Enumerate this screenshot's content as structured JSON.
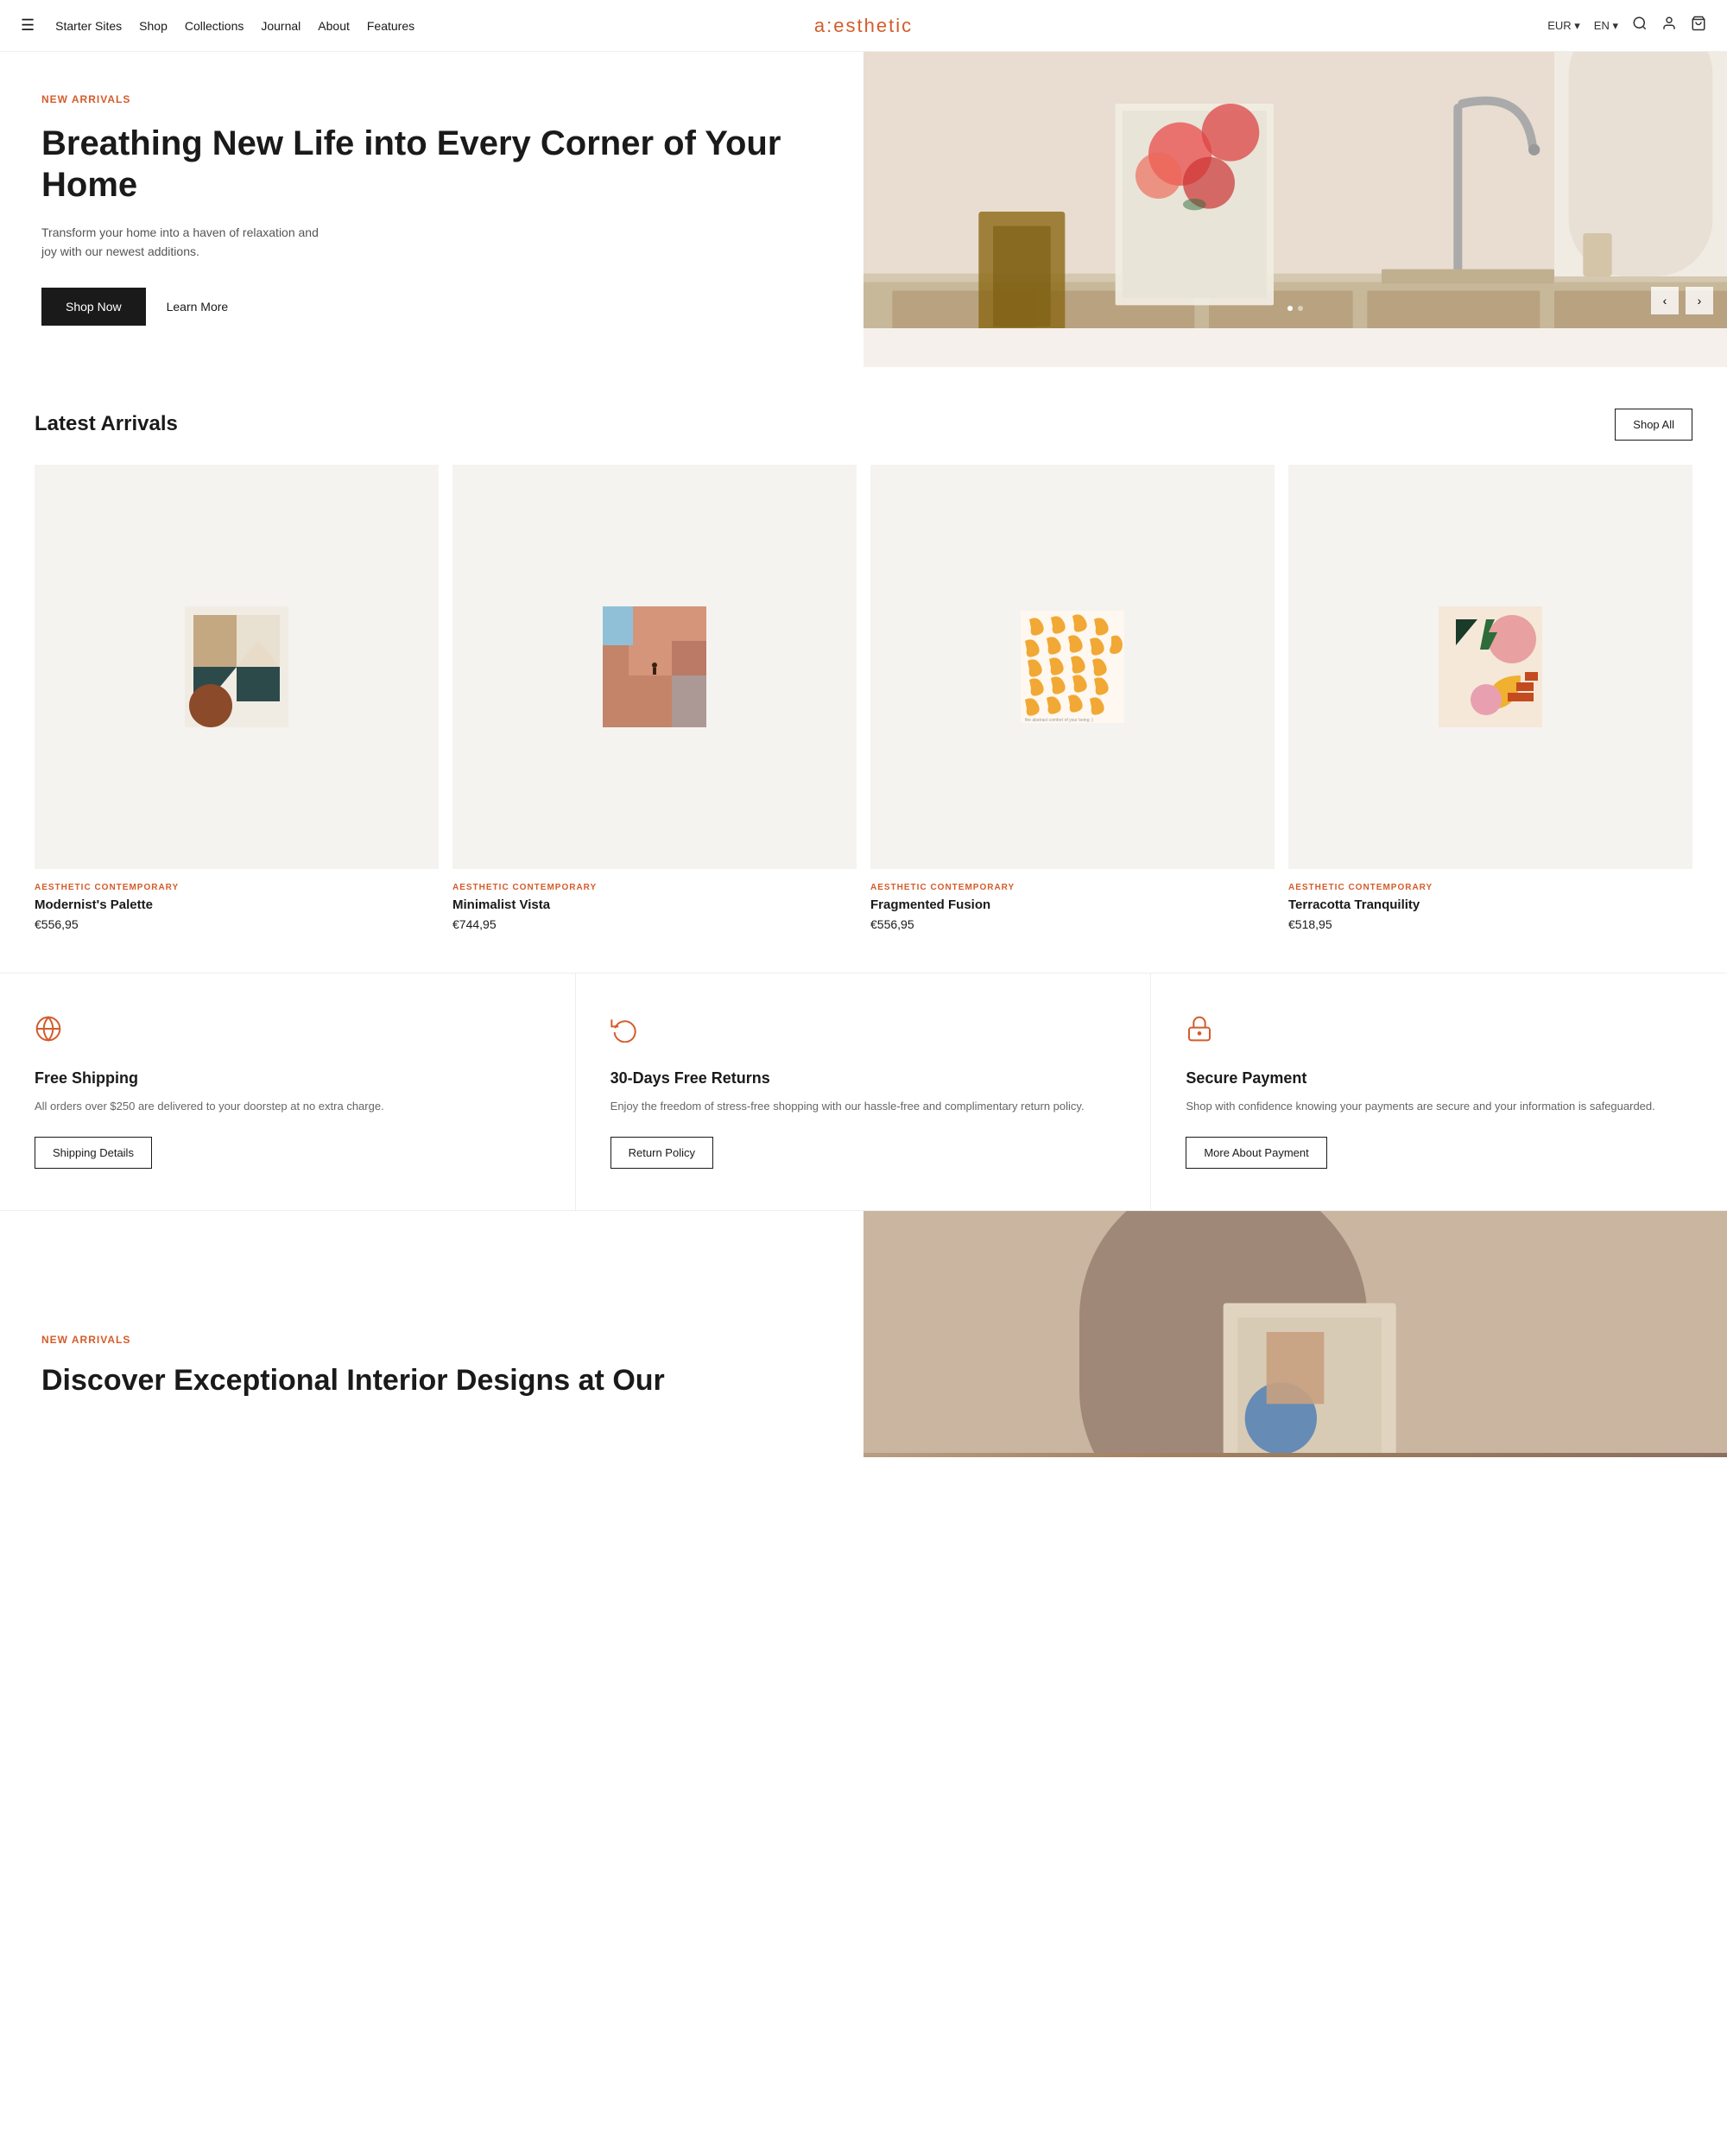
{
  "nav": {
    "hamburger": "☰",
    "links": [
      {
        "label": "Starter Sites",
        "id": "starter-sites"
      },
      {
        "label": "Shop",
        "id": "shop"
      },
      {
        "label": "Collections",
        "id": "collections"
      },
      {
        "label": "Journal",
        "id": "journal"
      },
      {
        "label": "About",
        "id": "about"
      },
      {
        "label": "Features",
        "id": "features"
      }
    ],
    "logo": "a:esthetic",
    "currency": "EUR ▾",
    "lang": "EN ▾"
  },
  "hero": {
    "tag": "NEW ARRIVALS",
    "title": "Breathing New Life into Every Corner of Your Home",
    "desc": "Transform your home into a haven of relaxation and joy with our newest additions.",
    "cta_primary": "Shop Now",
    "cta_link": "Learn More"
  },
  "latest_arrivals": {
    "section_title": "Latest Arrivals",
    "shop_all": "Shop All",
    "products": [
      {
        "tag": "AESTHETIC CONTEMPORARY",
        "name": "Modernist's Palette",
        "price": "€556,95"
      },
      {
        "tag": "AESTHETIC CONTEMPORARY",
        "name": "Minimalist Vista",
        "price": "€744,95"
      },
      {
        "tag": "AESTHETIC CONTEMPORARY",
        "name": "Fragmented Fusion",
        "price": "€556,95"
      },
      {
        "tag": "AESTHETIC CONTEMPORARY",
        "name": "Terracotta Tranquility",
        "price": "€518,95"
      }
    ]
  },
  "features": [
    {
      "icon": "globe",
      "title": "Free Shipping",
      "desc": "All orders over $250 are delivered to your doorstep at no extra charge.",
      "cta": "Shipping Details"
    },
    {
      "icon": "return",
      "title": "30-Days Free Returns",
      "desc": "Enjoy the freedom of stress-free shopping with our hassle-free and complimentary return policy.",
      "cta": "Return Policy"
    },
    {
      "icon": "lock",
      "title": "Secure Payment",
      "desc": "Shop with confidence knowing your payments are secure and your information is safeguarded.",
      "cta": "More About Payment"
    }
  ],
  "hero2": {
    "tag": "NEW ARRIVALS",
    "title": "Discover Exceptional Interior Designs at Our"
  }
}
